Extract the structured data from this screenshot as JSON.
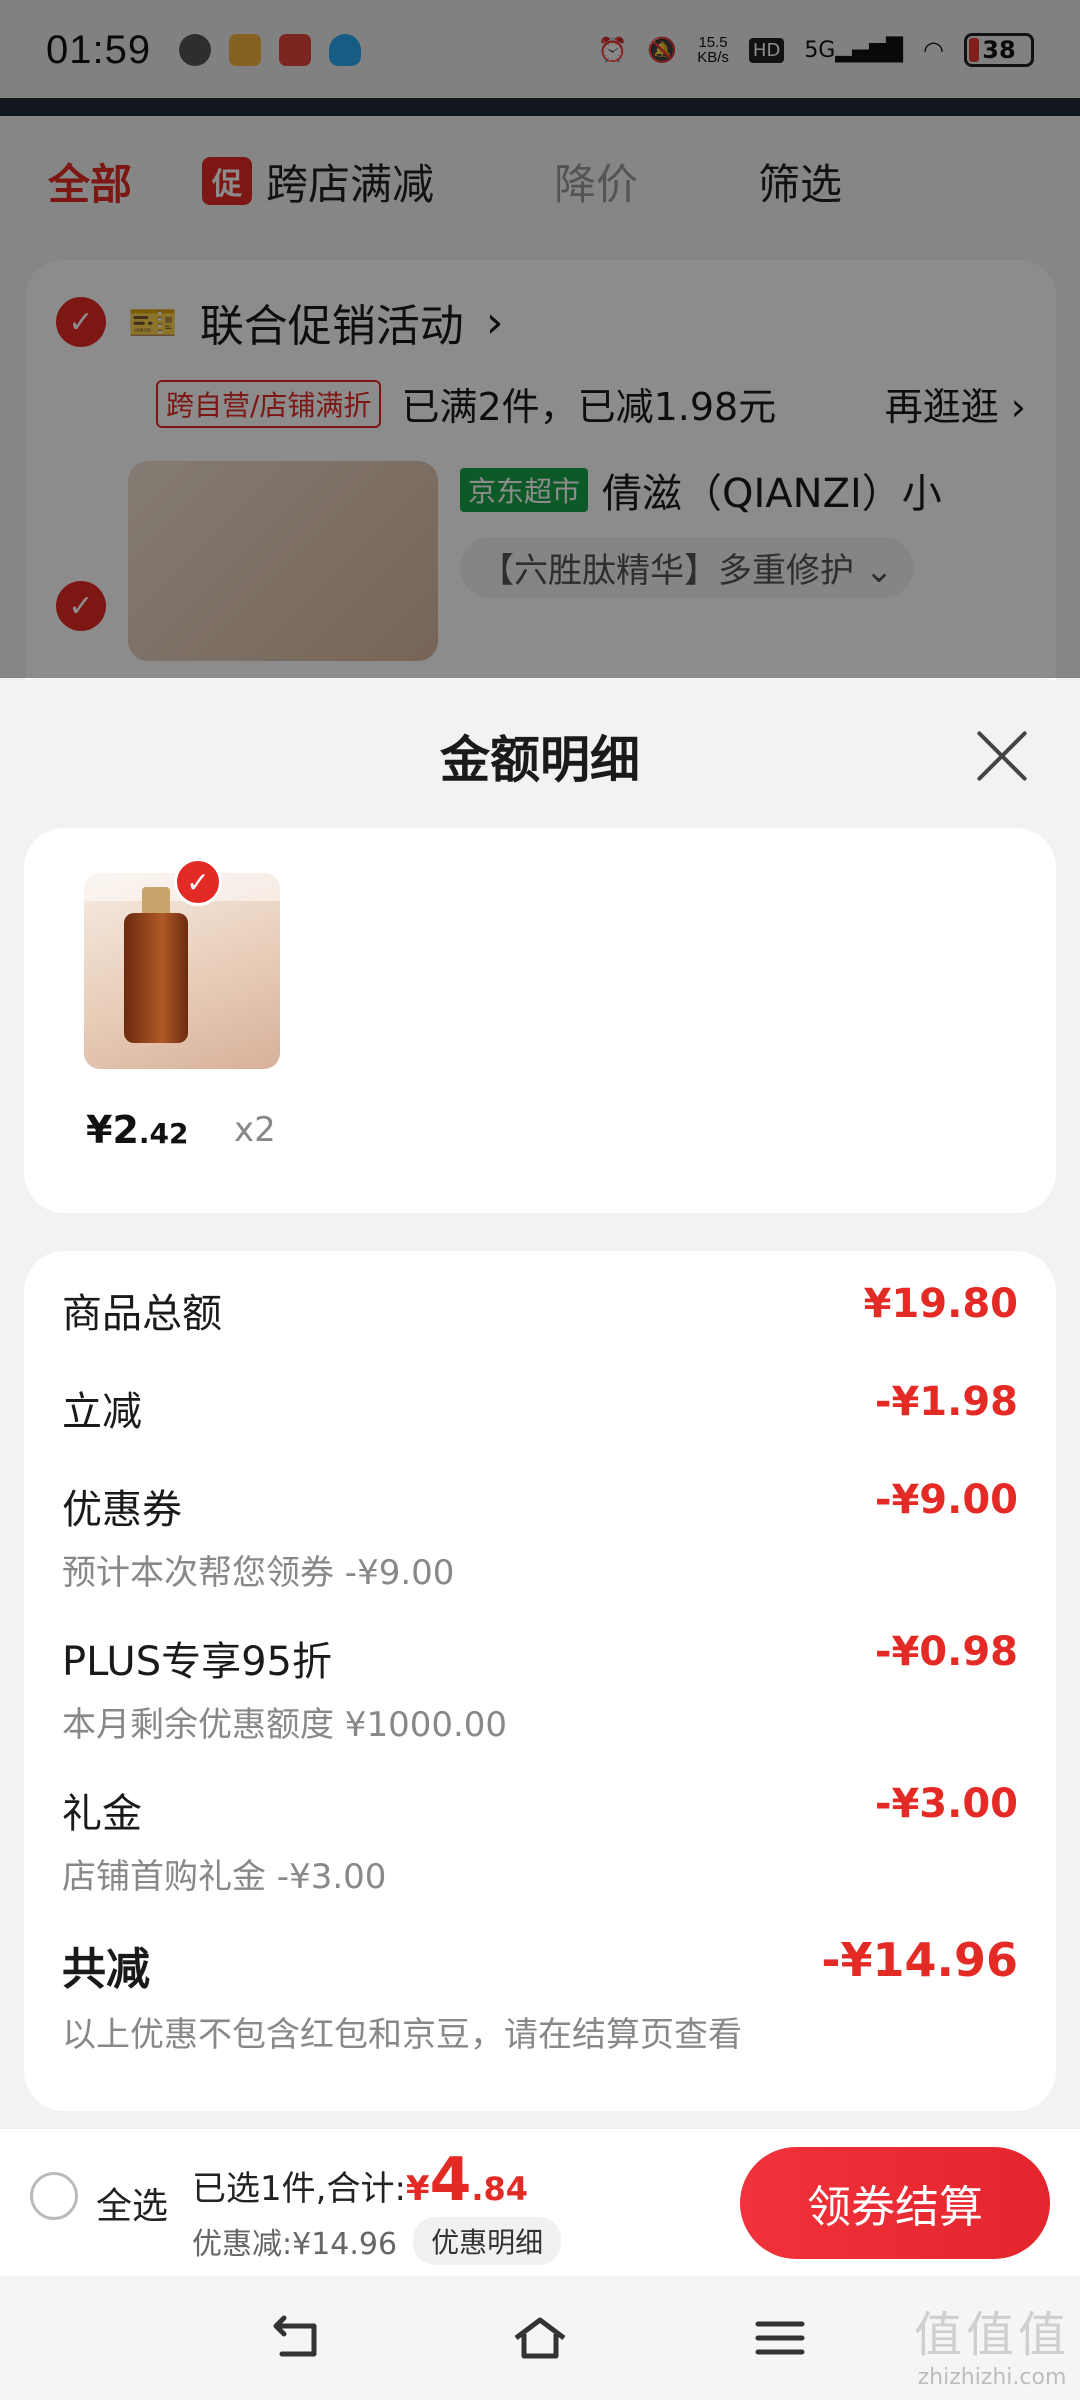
{
  "status_bar": {
    "time": "01:59",
    "net_speed_value": "15.5",
    "net_speed_unit": "KB/s",
    "hd": "HD",
    "net_type": "5G",
    "battery": "38"
  },
  "tabs": [
    {
      "label": "全部",
      "active": true
    },
    {
      "label": "跨店满减",
      "badge": "促"
    },
    {
      "label": "降价"
    },
    {
      "label": "筛选"
    }
  ],
  "bg_card": {
    "promo_title": "联合促销活动",
    "promo_tag": "跨自营/店铺满折",
    "promo_status": "已满2件，已减1.98元",
    "more_link": "再逛逛",
    "store_tag": "京东超市",
    "product_name": "倩滋（QIANZI）小",
    "variant": "【六胜肽精华】多重修护"
  },
  "sheet": {
    "title": "金额明细",
    "product": {
      "price_int": "¥2",
      "price_dec": ".42",
      "qty": "x2"
    },
    "lines": [
      {
        "label": "商品总额",
        "value": "¥19.80",
        "sub": ""
      },
      {
        "label": "立减",
        "value": "-¥1.98",
        "sub": ""
      },
      {
        "label": "优惠券",
        "value": "-¥9.00",
        "sub": "预计本次帮您领券 -¥9.00"
      },
      {
        "label": "PLUS专享95折",
        "value": "-¥0.98",
        "sub": "本月剩余优惠额度 ¥1000.00"
      },
      {
        "label": "礼金",
        "value": "-¥3.00",
        "sub": "店铺首购礼金 -¥3.00"
      }
    ],
    "total": {
      "label": "共减",
      "value": "-¥14.96",
      "sub": "以上优惠不包含红包和京豆，请在结算页查看"
    }
  },
  "bottom_bar": {
    "select_all": "全选",
    "summary_prefix": "已选1件,合计:",
    "currency": "¥",
    "total_int": "4",
    "total_dec": ".84",
    "discount_text": "优惠减:¥14.96",
    "detail_button": "优惠明细",
    "checkout_button": "领券结算"
  },
  "watermark": {
    "main": "值值值",
    "url": "zhizhizhi.com"
  },
  "colors": {
    "accent": "#e42a25",
    "jd_green": "#1aa34a"
  }
}
